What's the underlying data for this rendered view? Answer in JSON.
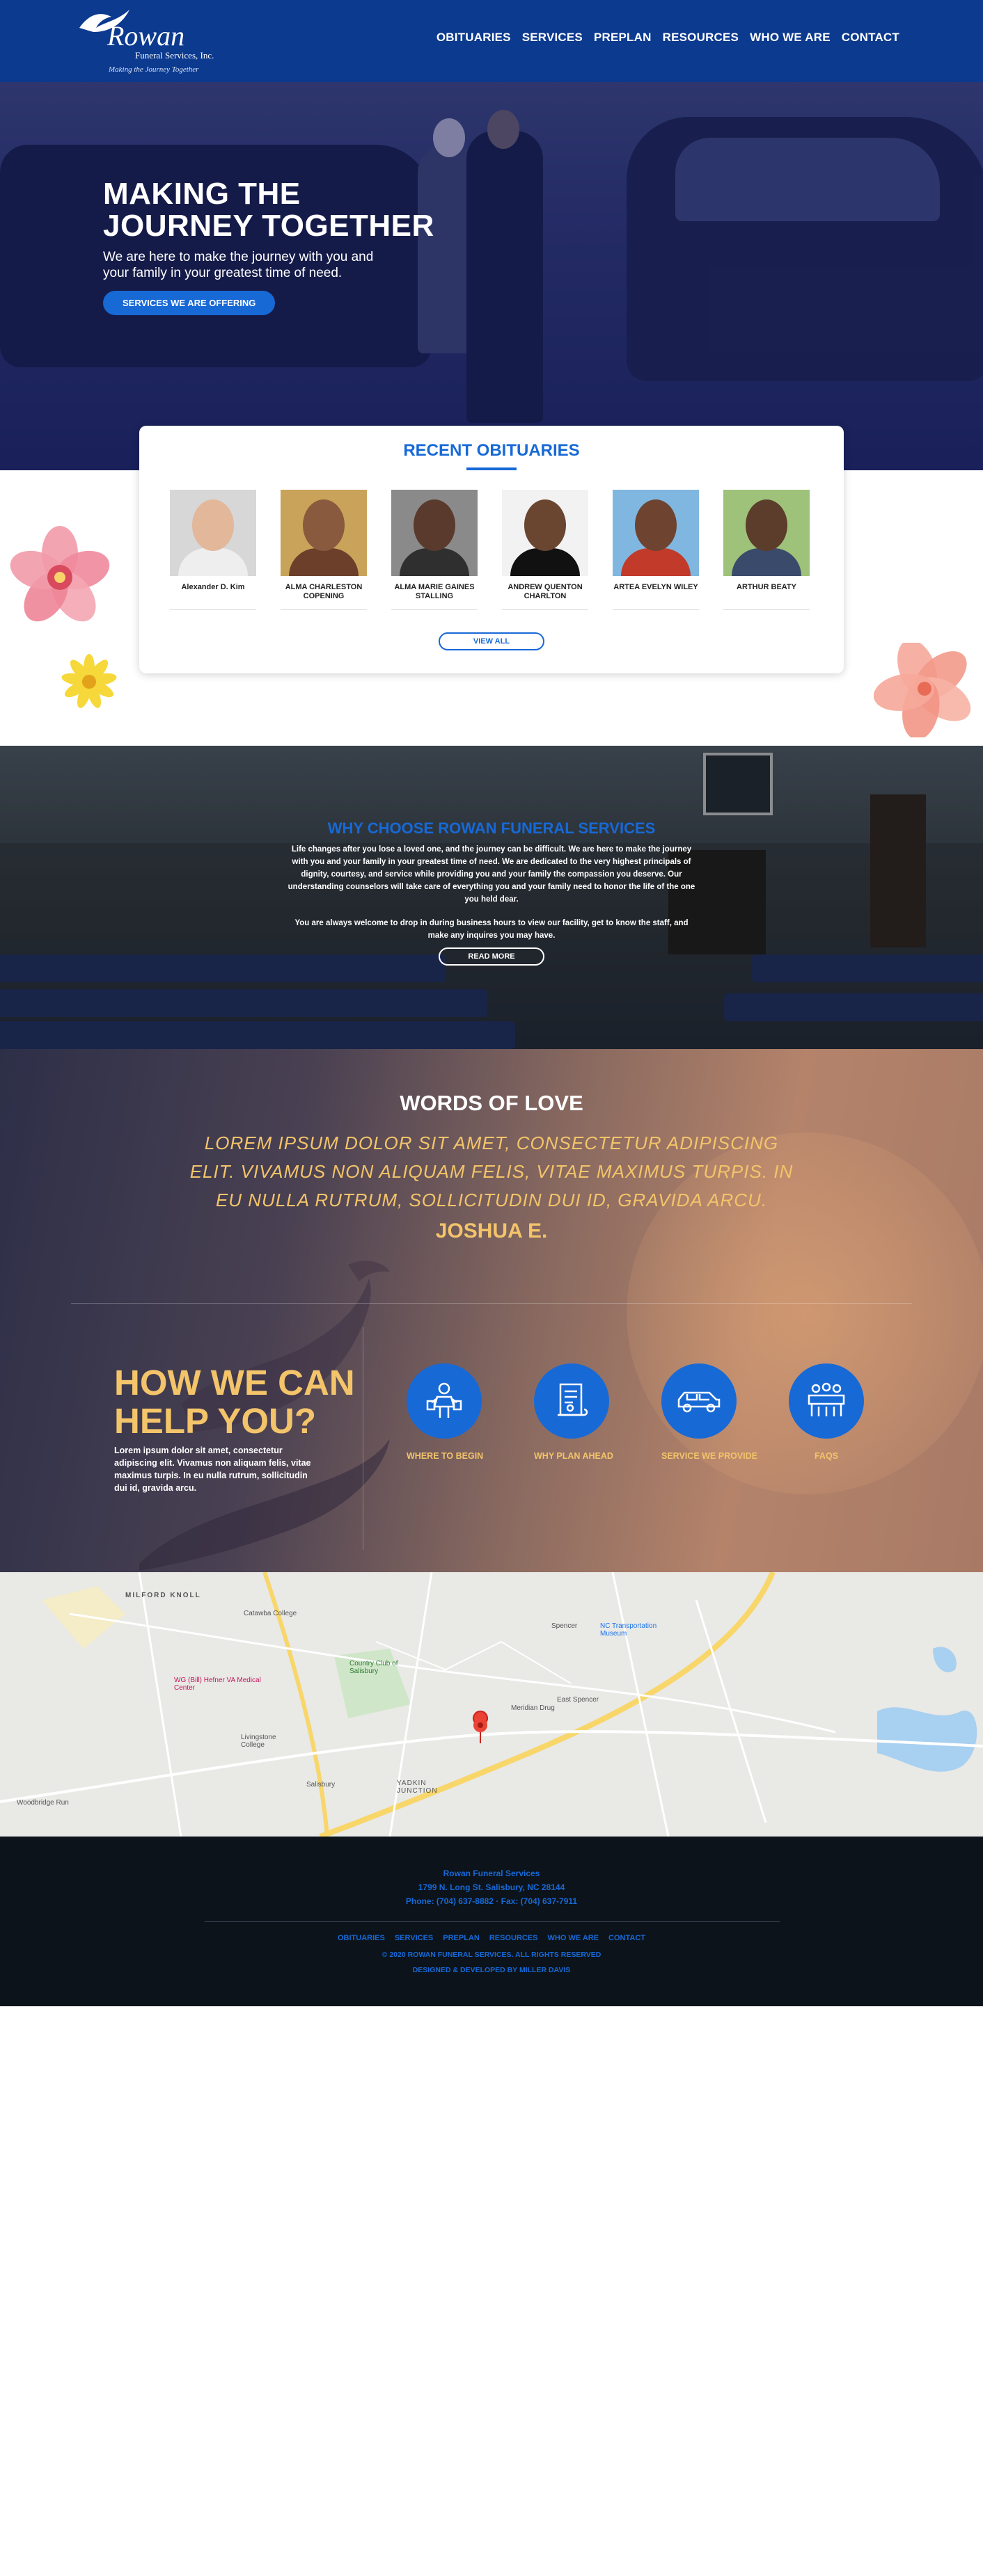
{
  "brand": {
    "name": "Rowan",
    "sub": "Funeral Services, Inc.",
    "tagline": "Making the Journey Together"
  },
  "nav": [
    "OBITUARIES",
    "SERVICES",
    "PREPLAN",
    "RESOURCES",
    "WHO  WE  ARE",
    "CONTACT"
  ],
  "hero": {
    "title_line1": "MAKING THE",
    "title_line2": "JOURNEY TOGETHER",
    "subtitle": "We are here to make the journey with you and your family in your greatest time of need.",
    "button": "SERVICES WE ARE OFFERING"
  },
  "obituaries": {
    "title": "RECENT OBITUARIES",
    "items": [
      {
        "name": "Alexander D. Kim",
        "skin": "#e2b79a",
        "bg": "#d7d7d7",
        "shirt": "#eeeeee"
      },
      {
        "name": "ALMA CHARLESTON COPENING",
        "skin": "#8a5a3e",
        "bg": "#c9a35a",
        "shirt": "#6b3f2a"
      },
      {
        "name": "ALMA MARIE GAINES STALLING",
        "skin": "#5a3a2c",
        "bg": "#8a8a8a",
        "shirt": "#2f2f2f"
      },
      {
        "name": "ANDREW QUENTON CHARLTON",
        "skin": "#6a4530",
        "bg": "#f2f2f2",
        "shirt": "#111111"
      },
      {
        "name": "ARTEA EVELYN WILEY",
        "skin": "#6e4330",
        "bg": "#7fb7e0",
        "shirt": "#c13a2a"
      },
      {
        "name": "ARTHUR BEATY",
        "skin": "#5c3c2a",
        "bg": "#9fc27a",
        "shirt": "#3a4a6a"
      }
    ],
    "button": "VIEW ALL"
  },
  "why": {
    "title": "WHY CHOOSE ROWAN FUNERAL SERVICES",
    "para1": "Life changes after you lose a loved one, and the journey can be difficult. We are here to make the journey with you and your family in your greatest time of need. We are dedicated to the very highest principals of dignity, courtesy, and service while providing you and your family the compassion you deserve. Our understanding counselors will take care of everything you and your family need to honor the life of the one you held dear.",
    "para2": "You are always welcome to drop in during business hours to view our facility, get to know the staff, and make any inquires you may have.",
    "button": "READ MORE"
  },
  "love": {
    "title": "WORDS OF LOVE",
    "quote": "LOREM IPSUM DOLOR SIT AMET, CONSECTETUR ADIPISCING ELIT. VIVAMUS NON ALIQUAM FELIS, VITAE MAXIMUS TURPIS. IN EU NULLA RUTRUM, SOLLICITUDIN DUI ID, GRAVIDA ARCU.",
    "author": "JOSHUA E."
  },
  "help": {
    "title_line1": "HOW WE CAN",
    "title_line2": "HELP YOU?",
    "text": "Lorem ipsum dolor sit amet, consectetur adipiscing elit. Vivamus non aliquam felis, vitae maximus turpis. In eu nulla rutrum, sollicitudin dui id, gravida arcu.",
    "items": [
      {
        "label": "WHERE TO BEGIN",
        "icon": "person-map-icon"
      },
      {
        "label": "WHY PLAN AHEAD",
        "icon": "scroll-document-icon"
      },
      {
        "label": "SERVICE WE PROVIDE",
        "icon": "hearse-icon"
      },
      {
        "label": "FAQS",
        "icon": "group-meeting-icon"
      }
    ]
  },
  "map": {
    "labels": [
      "MILFORD KNOLL",
      "Catawba College",
      "NC Transportation Museum",
      "Spencer",
      "Country Club of Salisbury",
      "WG (Bill) Hefner VA Medical Center",
      "Livingstone College",
      "Meridian Drug",
      "East Spencer",
      "Salisbury",
      "YADKIN JUNCTION",
      "Woodbridge Run"
    ]
  },
  "footer": {
    "name": "Rowan Funeral Services",
    "address": "1799 N. Long St. Salisbury, NC 28144",
    "phone": "Phone: (704) 637-8882  ·  Fax: (704) 637-7911",
    "nav": [
      "OBITUARIES",
      "SERVICES",
      "PREPLAN",
      "RESOURCES",
      "WHO  WE  ARE",
      "CONTACT"
    ],
    "copyright": "© 2020 ROWAN FUNERAL SERVICES. ALL RIGHTS RESERVED",
    "developer": "DESIGNED & DEVELOPED BY MILLER DAVIS"
  },
  "colors": {
    "header": "#0b3a8f",
    "accent_blue": "#1769d6",
    "gold": "#f3c46a",
    "footer": "#0c131b"
  }
}
